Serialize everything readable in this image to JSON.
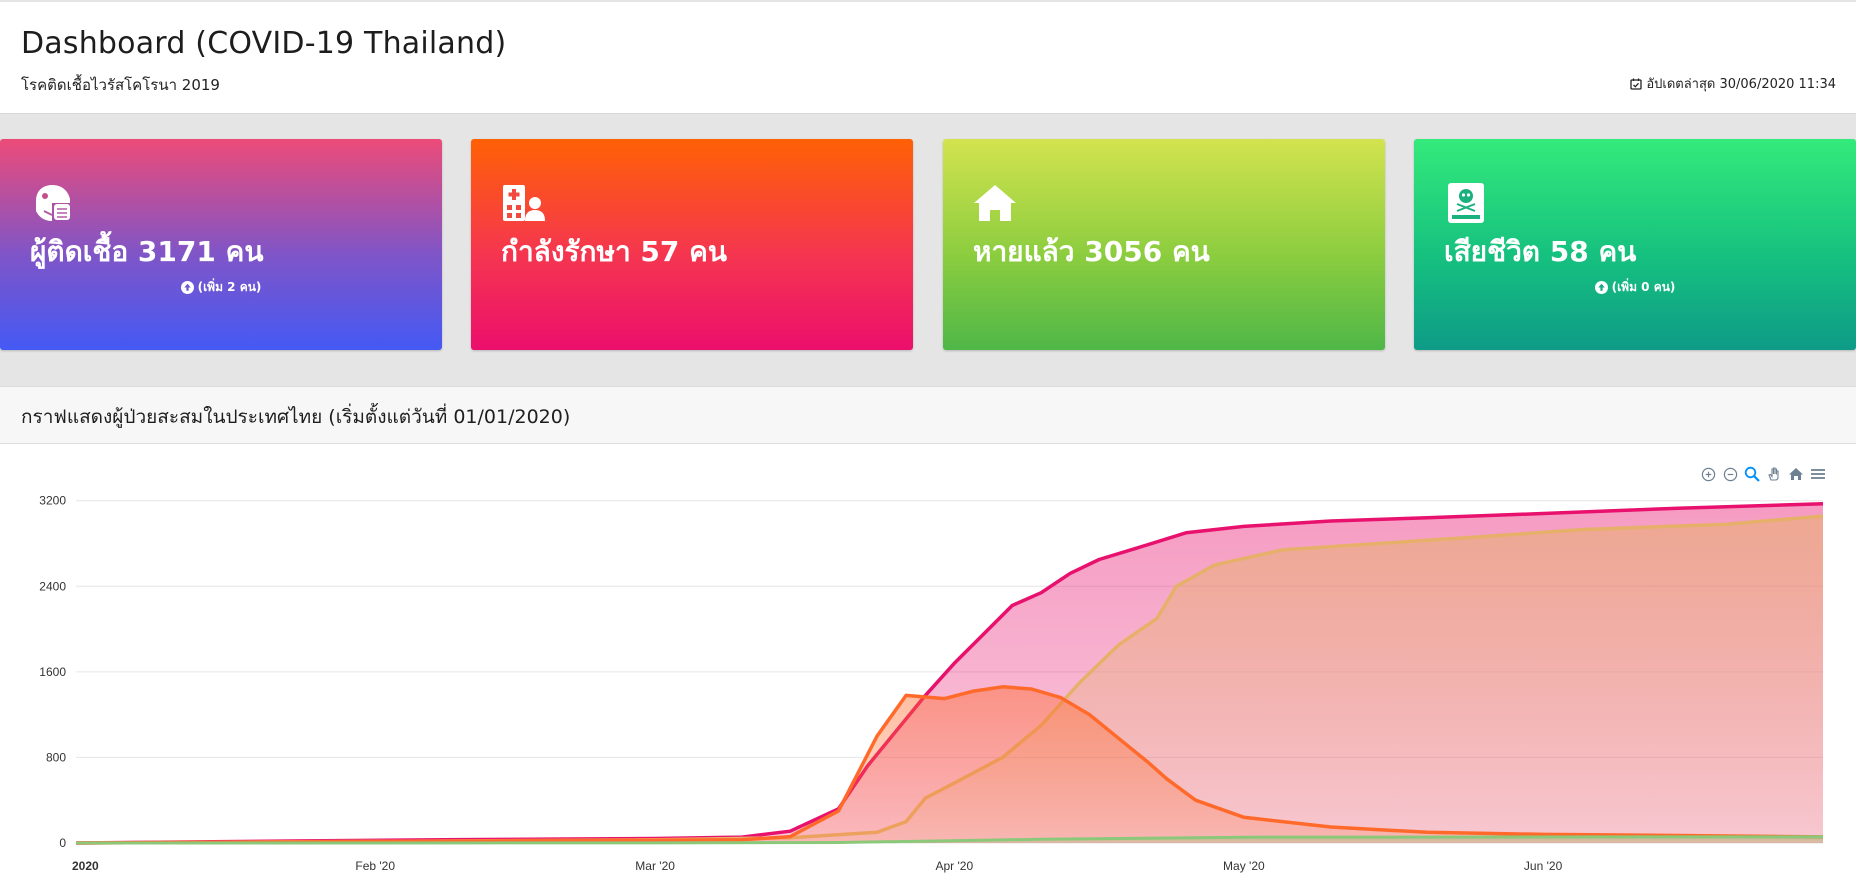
{
  "header": {
    "title": "Dashboard (COVID-19 Thailand)",
    "subtitle": "โรคติดเชื้อไวรัสโคโรนา 2019",
    "updated": "อัปเดตล่าสุด 30/06/2020 11:34"
  },
  "cards": [
    {
      "icon": "mask-face-icon",
      "label": "ผู้ติดเชื้อ 3171 คน",
      "delta": "(เพิ่ม 2 คน)"
    },
    {
      "icon": "hospital-user-icon",
      "label": "กำลังรักษา 57 คน",
      "delta": ""
    },
    {
      "icon": "home-icon",
      "label": "หายแล้ว 3056 คน",
      "delta": ""
    },
    {
      "icon": "book-skull-icon",
      "label": "เสียชีวิต 58 คน",
      "delta": "(เพิ่ม 0 คน)"
    }
  ],
  "chart": {
    "title": "กราฟแสดงผู้ป่วยสะสมในประเทศไทย (เริ่มตั้งแต่วันที่ 01/01/2020)",
    "toolbar": [
      "zoom-in-icon",
      "zoom-out-icon",
      "selection-zoom-icon",
      "pan-hand-icon",
      "reset-home-icon",
      "menu-icon"
    ]
  },
  "colors": {
    "confirmed": "#e8116d",
    "treating": "#ff6a2b",
    "recovered": "#e7b06a",
    "deaths": "#8cc87a"
  },
  "chart_data": {
    "type": "area",
    "x_ticks": [
      "2020",
      "Feb '20",
      "Mar '20",
      "Apr '20",
      "May '20",
      "Jun '20"
    ],
    "y_ticks": [
      0,
      800,
      1600,
      2400,
      3200
    ],
    "ylim": [
      0,
      3300
    ],
    "xlim": [
      "2020-01-01",
      "2020-06-30"
    ],
    "grid": true,
    "series": [
      {
        "key": "confirmed",
        "x": [
          "2020-01-01",
          "2020-01-25",
          "2020-02-10",
          "2020-03-01",
          "2020-03-10",
          "2020-03-15",
          "2020-03-20",
          "2020-03-23",
          "2020-03-26",
          "2020-03-29",
          "2020-04-01",
          "2020-04-04",
          "2020-04-07",
          "2020-04-10",
          "2020-04-13",
          "2020-04-16",
          "2020-04-20",
          "2020-04-25",
          "2020-05-01",
          "2020-05-10",
          "2020-05-20",
          "2020-06-01",
          "2020-06-15",
          "2020-06-30"
        ],
        "values": [
          0,
          20,
          32,
          42,
          55,
          110,
          320,
          720,
          1050,
          1380,
          1680,
          1950,
          2220,
          2340,
          2520,
          2650,
          2760,
          2900,
          2960,
          3010,
          3040,
          3080,
          3130,
          3171
        ]
      },
      {
        "key": "treating",
        "x": [
          "2020-01-01",
          "2020-03-10",
          "2020-03-15",
          "2020-03-20",
          "2020-03-24",
          "2020-03-27",
          "2020-03-31",
          "2020-04-03",
          "2020-04-06",
          "2020-04-09",
          "2020-04-12",
          "2020-04-15",
          "2020-04-18",
          "2020-04-21",
          "2020-04-23",
          "2020-04-26",
          "2020-05-01",
          "2020-05-10",
          "2020-05-20",
          "2020-06-01",
          "2020-06-15",
          "2020-06-30"
        ],
        "values": [
          0,
          30,
          60,
          300,
          1000,
          1380,
          1350,
          1420,
          1460,
          1440,
          1360,
          1200,
          980,
          760,
          600,
          400,
          240,
          150,
          100,
          80,
          70,
          57
        ]
      },
      {
        "key": "recovered",
        "x": [
          "2020-01-01",
          "2020-03-01",
          "2020-03-15",
          "2020-03-24",
          "2020-03-27",
          "2020-03-29",
          "2020-04-01",
          "2020-04-06",
          "2020-04-10",
          "2020-04-14",
          "2020-04-18",
          "2020-04-22",
          "2020-04-24",
          "2020-04-28",
          "2020-05-05",
          "2020-05-15",
          "2020-05-25",
          "2020-06-05",
          "2020-06-20",
          "2020-06-30"
        ],
        "values": [
          0,
          30,
          50,
          100,
          200,
          420,
          560,
          800,
          1100,
          1500,
          1850,
          2100,
          2400,
          2600,
          2740,
          2800,
          2860,
          2930,
          2980,
          3056
        ]
      },
      {
        "key": "deaths",
        "x": [
          "2020-01-01",
          "2020-03-01",
          "2020-03-20",
          "2020-04-10",
          "2020-05-01",
          "2020-06-30"
        ],
        "values": [
          0,
          1,
          5,
          35,
          54,
          58
        ]
      }
    ]
  }
}
